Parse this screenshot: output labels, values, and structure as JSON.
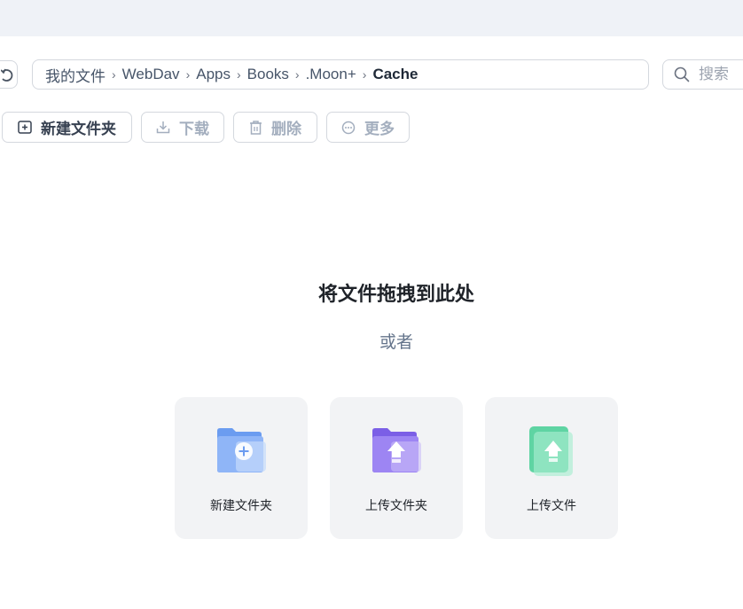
{
  "breadcrumb": {
    "items": [
      "我的文件",
      "WebDav",
      "Apps",
      "Books",
      ".Moon+",
      "Cache"
    ],
    "separator": "›"
  },
  "search": {
    "placeholder": "搜索"
  },
  "toolbar": {
    "new_folder": "新建文件夹",
    "download": "下载",
    "delete": "删除",
    "more": "更多"
  },
  "dropzone": {
    "title": "将文件拖拽到此处",
    "or": "或者",
    "cards": [
      {
        "label": "新建文件夹",
        "icon": "new-folder-icon",
        "color": "#6b9cf0"
      },
      {
        "label": "上传文件夹",
        "icon": "upload-folder-icon",
        "color": "#8a6ef0"
      },
      {
        "label": "上传文件",
        "icon": "upload-file-icon",
        "color": "#5fd4a3"
      }
    ]
  },
  "colors": {
    "topbar": "#eff2f7",
    "border": "#d4d8de",
    "card_bg": "#f2f3f5",
    "disabled_text": "#a3aebe"
  }
}
